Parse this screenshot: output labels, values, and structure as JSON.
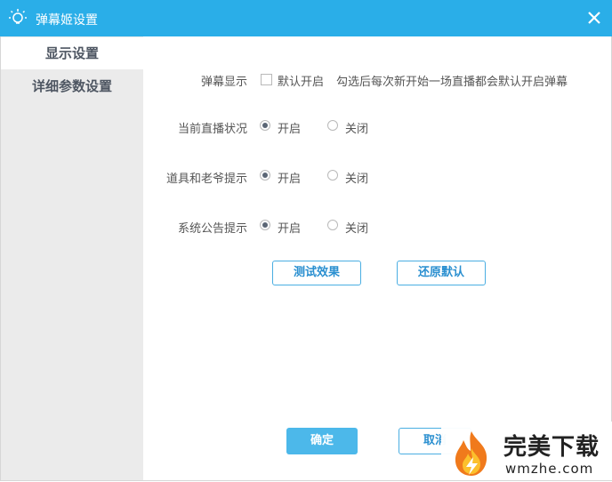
{
  "window": {
    "title": "弹幕姬设置",
    "icon": "lightbulb-icon",
    "close_icon": "close-icon",
    "accent": "#2aaee8"
  },
  "sidebar": {
    "items": [
      {
        "label": "显示设置",
        "active": true
      },
      {
        "label": "详细参数设置",
        "active": false
      }
    ]
  },
  "settings": {
    "danmaku_display": {
      "label": "弹幕显示",
      "checkbox_label": "默认开启",
      "checked": false,
      "hint": "勾选后每次新开始一场直播都会默认开启弹幕"
    },
    "live_status": {
      "label": "当前直播状况",
      "on_label": "开启",
      "off_label": "关闭",
      "value": "开启"
    },
    "props_tips": {
      "label": "道具和老爷提示",
      "on_label": "开启",
      "off_label": "关闭",
      "value": "开启"
    },
    "system_notice": {
      "label": "系统公告提示",
      "on_label": "开启",
      "off_label": "关闭",
      "value": "开启"
    }
  },
  "actions": {
    "test_label": "测试效果",
    "restore_label": "还原默认",
    "confirm_label": "确定",
    "cancel_label": "取消"
  },
  "watermark": {
    "title": "完美下载",
    "url": "wmzhe.com"
  }
}
